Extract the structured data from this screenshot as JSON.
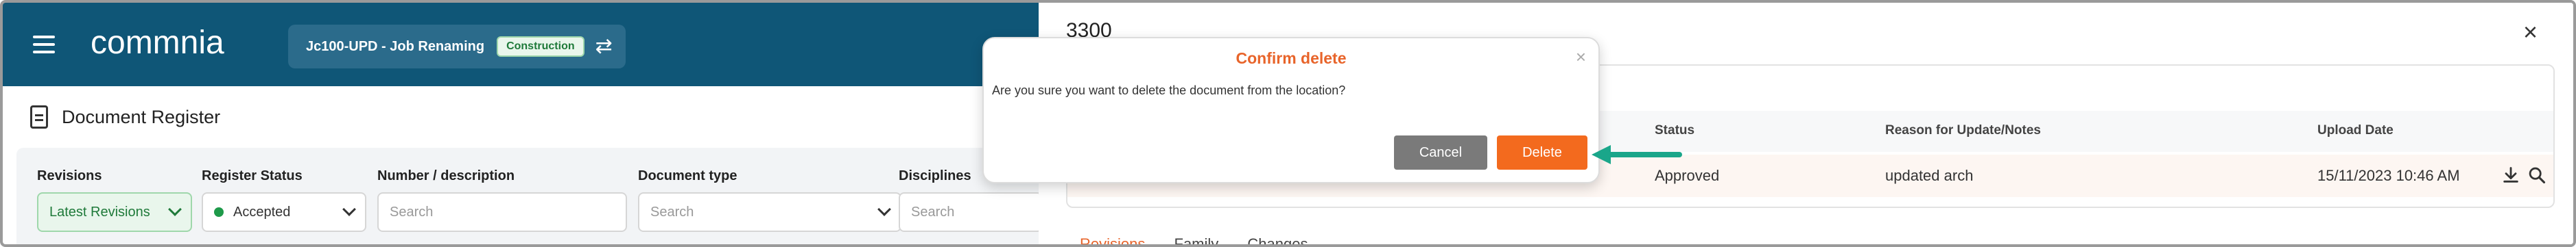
{
  "app": {
    "logo_text": "commnia",
    "project_name": "Jc100-UPD - Job Renaming",
    "project_badge": "Construction",
    "page_title": "Document Register"
  },
  "filters": {
    "revisions": {
      "label": "Revisions",
      "value": "Latest Revisions"
    },
    "register_status": {
      "label": "Register Status",
      "value": "Accepted"
    },
    "number": {
      "label": "Number / description",
      "placeholder": "Search"
    },
    "document_type": {
      "label": "Document type",
      "placeholder": "Search"
    },
    "disciplines": {
      "label": "Disciplines",
      "placeholder": "Search"
    }
  },
  "panel": {
    "title": "3300",
    "close_symbol": "×",
    "table": {
      "headers": [
        "Status",
        "Reason for Update/Notes",
        "Upload Date"
      ],
      "row": {
        "status": "Approved",
        "reason": "updated arch",
        "upload_date": "15/11/2023 10:46 AM"
      }
    },
    "tabs": [
      "Revisions",
      "Family",
      "Changes"
    ]
  },
  "modal": {
    "title": "Confirm delete",
    "close_symbol": "×",
    "message": "Are you sure you want to delete the document from the location?",
    "cancel_label": "Cancel",
    "delete_label": "Delete"
  },
  "colors": {
    "topbar": "#0f5677",
    "accent_orange": "#f36a1e",
    "cancel_gray": "#7a7a7a",
    "arrow_teal": "#1aa68a",
    "status_green": "#1e9a4a"
  },
  "icons": [
    "hamburger-icon",
    "swap-icon",
    "document-icon",
    "chevron-down-icon",
    "download-icon",
    "search-icon",
    "close-icon",
    "arrow-left-icon"
  ]
}
